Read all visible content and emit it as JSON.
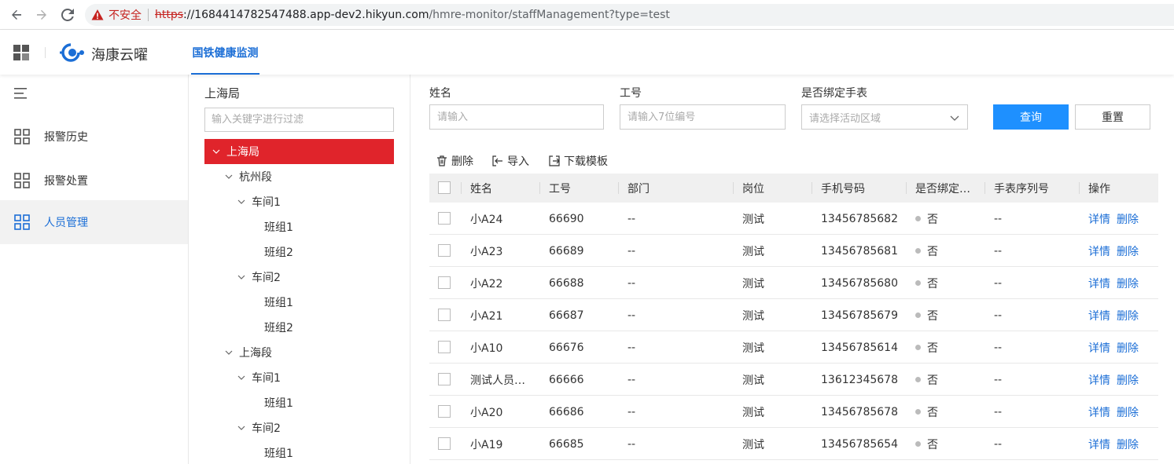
{
  "browser": {
    "insecure_label": "不安全",
    "url_proto": "https",
    "url_host": "://1684414782547488.app-dev2.hikyun.com",
    "url_path": "/hmre-monitor/staffManagement?type=test"
  },
  "header": {
    "brand": "海康云曜",
    "tab": "国铁健康监测"
  },
  "sidebar": {
    "items": [
      {
        "label": "报警历史",
        "icon": "grid-icon"
      },
      {
        "label": "报警处置",
        "icon": "grid-icon"
      },
      {
        "label": "人员管理",
        "icon": "grid-icon",
        "active": true
      }
    ]
  },
  "tree": {
    "title": "上海局",
    "search_placeholder": "输入关键字进行过滤",
    "nodes": [
      {
        "label": "上海局",
        "level": 0,
        "expanded": true,
        "selected": true
      },
      {
        "label": "杭州段",
        "level": 1,
        "expanded": true
      },
      {
        "label": "车间1",
        "level": 2,
        "expanded": true
      },
      {
        "label": "班组1",
        "level": 3
      },
      {
        "label": "班组2",
        "level": 3
      },
      {
        "label": "车间2",
        "level": 2,
        "expanded": true
      },
      {
        "label": "班组1",
        "level": 3
      },
      {
        "label": "班组2",
        "level": 3
      },
      {
        "label": "上海段",
        "level": 1,
        "expanded": true
      },
      {
        "label": "车间1",
        "level": 2,
        "expanded": true
      },
      {
        "label": "班组1",
        "level": 3
      },
      {
        "label": "车间2",
        "level": 2,
        "expanded": true
      },
      {
        "label": "班组1",
        "level": 3
      }
    ]
  },
  "filters": {
    "name_label": "姓名",
    "name_placeholder": "请输入",
    "id_label": "工号",
    "id_placeholder": "请输入7位编号",
    "bound_label": "是否绑定手表",
    "bound_placeholder": "请选择活动区域",
    "query_button": "查询",
    "reset_button": "重置"
  },
  "toolbar": {
    "delete": "删除",
    "import": "导入",
    "template": "下载模板"
  },
  "table": {
    "columns": [
      "姓名",
      "工号",
      "部门",
      "岗位",
      "手机号码",
      "是否绑定…",
      "手表序列号",
      "操作"
    ],
    "detail_label": "详情",
    "delete_label": "删除",
    "rows": [
      {
        "name": "小A24",
        "id": "66690",
        "dept": "--",
        "post": "测试",
        "phone": "13456785682",
        "bound": "否",
        "serial": "--"
      },
      {
        "name": "小A23",
        "id": "66689",
        "dept": "--",
        "post": "测试",
        "phone": "13456785681",
        "bound": "否",
        "serial": "--"
      },
      {
        "name": "小A22",
        "id": "66688",
        "dept": "--",
        "post": "测试",
        "phone": "13456785680",
        "bound": "否",
        "serial": "--"
      },
      {
        "name": "小A21",
        "id": "66687",
        "dept": "--",
        "post": "测试",
        "phone": "13456785679",
        "bound": "否",
        "serial": "--"
      },
      {
        "name": "小A10",
        "id": "66676",
        "dept": "--",
        "post": "测试",
        "phone": "13456785614",
        "bound": "否",
        "serial": "--"
      },
      {
        "name": "测试人员…",
        "id": "66666",
        "dept": "--",
        "post": "测试",
        "phone": "13612345678",
        "bound": "否",
        "serial": "--"
      },
      {
        "name": "小A20",
        "id": "66686",
        "dept": "--",
        "post": "测试",
        "phone": "13456785678",
        "bound": "否",
        "serial": "--"
      },
      {
        "name": "小A19",
        "id": "66685",
        "dept": "--",
        "post": "测试",
        "phone": "13456785654",
        "bound": "否",
        "serial": "--"
      }
    ]
  },
  "colors": {
    "primary": "#1e90ff",
    "link": "#1b6ed6",
    "selected_node": "#e0242b"
  }
}
